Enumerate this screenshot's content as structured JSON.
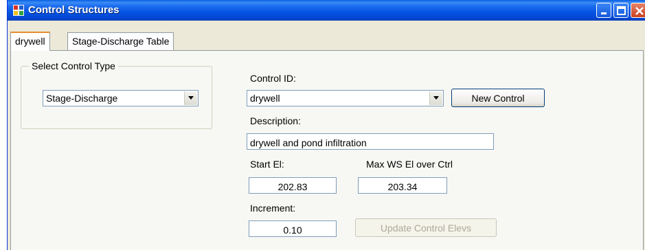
{
  "window": {
    "title": "Control Structures"
  },
  "tabs": [
    {
      "label": "drywell",
      "active": true
    },
    {
      "label": "Stage-Discharge Table",
      "active": false
    }
  ],
  "control_type_group": {
    "legend": "Select Control Type",
    "selected": "Stage-Discharge"
  },
  "form": {
    "control_id_label": "Control ID:",
    "control_id_value": "drywell",
    "new_control_label": "New Control",
    "description_label": "Description:",
    "description_value": "drywell and pond infiltration",
    "start_el_label": "Start El:",
    "start_el_value": "202.83",
    "max_ws_label": "Max WS El over Ctrl",
    "max_ws_value": "203.34",
    "increment_label": "Increment:",
    "increment_value": "0.10",
    "update_label": "Update Control Elevs"
  },
  "colors": {
    "titlebar": "#0553e2",
    "face": "#ece9d8",
    "tab_highlight": "#e68b2c"
  }
}
